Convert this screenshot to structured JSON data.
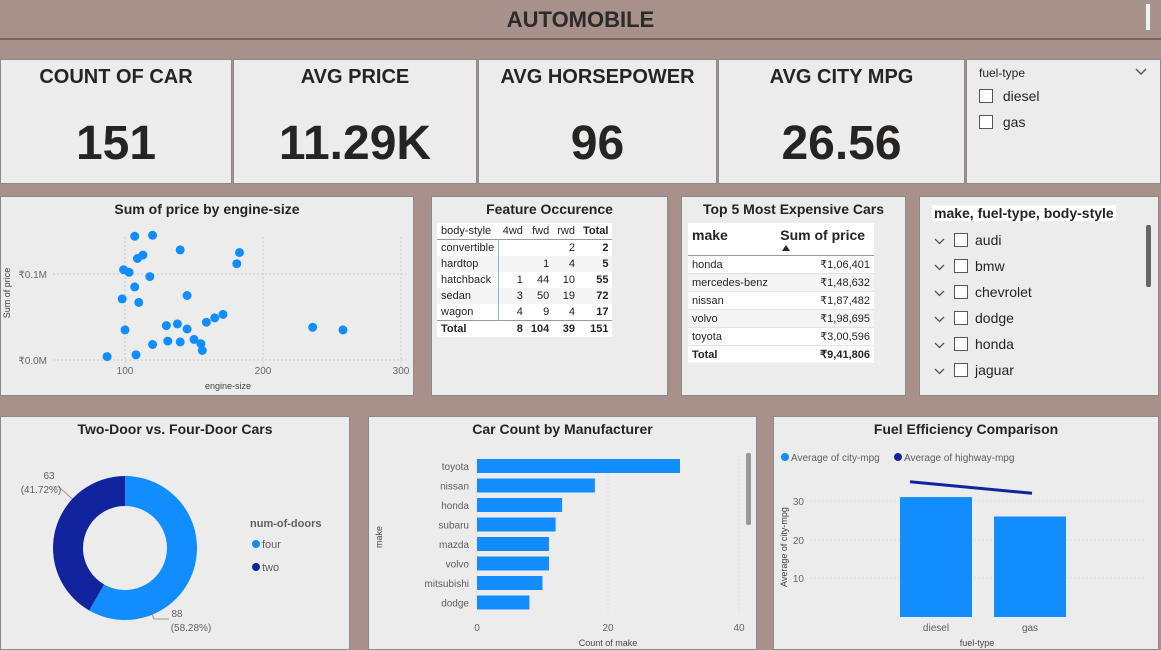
{
  "header": {
    "title": "AUTOMOBILE"
  },
  "cards": [
    {
      "label": "COUNT OF CAR",
      "value": "151"
    },
    {
      "label": "AVG PRICE",
      "value": "11.29K"
    },
    {
      "label": "AVG HORSEPOWER",
      "value": "96"
    },
    {
      "label": "AVG CITY MPG",
      "value": "26.56"
    }
  ],
  "fuel_slicer": {
    "title": "fuel-type",
    "options": [
      "diesel",
      "gas"
    ]
  },
  "scatter": {
    "title": "Sum of price by engine-size",
    "xlabel": "engine-size",
    "ylabel": "Sum of price",
    "xticks": [
      "100",
      "200",
      "300"
    ],
    "yticks": [
      "₹0.0M",
      "₹0.1M"
    ]
  },
  "feature_matrix": {
    "title": "Feature Occurence",
    "headers": [
      "body-style",
      "4wd",
      "fwd",
      "rwd",
      "Total"
    ],
    "rows": [
      [
        "convertible",
        "",
        "",
        "2",
        "2"
      ],
      [
        "hardtop",
        "",
        "1",
        "4",
        "5"
      ],
      [
        "hatchback",
        "1",
        "44",
        "10",
        "55"
      ],
      [
        "sedan",
        "3",
        "50",
        "19",
        "72"
      ],
      [
        "wagon",
        "4",
        "9",
        "4",
        "17"
      ]
    ],
    "total": [
      "Total",
      "8",
      "104",
      "39",
      "151"
    ]
  },
  "top5": {
    "title": "Top 5 Most Expensive Cars",
    "headers": [
      "make",
      "Sum of price"
    ],
    "rows": [
      [
        "honda",
        "₹1,06,401"
      ],
      [
        "mercedes-benz",
        "₹1,48,632"
      ],
      [
        "nissan",
        "₹1,87,482"
      ],
      [
        "volvo",
        "₹1,98,695"
      ],
      [
        "toyota",
        "₹3,00,596"
      ]
    ],
    "total": [
      "Total",
      "₹9,41,806"
    ]
  },
  "make_slicer": {
    "title": "make, fuel-type, body-style",
    "items": [
      "audi",
      "bmw",
      "chevrolet",
      "dodge",
      "honda",
      "jaguar"
    ]
  },
  "donut": {
    "title": "Two-Door vs. Four-Door Cars",
    "legend_title": "num-of-doors",
    "labels": [
      {
        "count": "63",
        "pct": "(41.72%)"
      },
      {
        "count": "88",
        "pct": "(58.28%)"
      }
    ]
  },
  "bar": {
    "title": "Car Count by Manufacturer",
    "xlabel": "Count of make",
    "ylabel": "make",
    "xticks": [
      "0",
      "20",
      "40"
    ]
  },
  "fuel_eff": {
    "title": "Fuel Efficiency Comparison",
    "ylabel": "Average of city-mpg",
    "xlabel": "fuel-type",
    "yticks": [
      "10",
      "20",
      "30"
    ]
  },
  "colors": {
    "primary": "#118dff",
    "secondary": "#12239e",
    "panel": "#ececec",
    "background": "#a8918a"
  },
  "chart_data": [
    {
      "type": "scatter",
      "title": "Sum of price by engine-size",
      "xlabel": "engine-size",
      "ylabel": "Sum of price",
      "xlim": [
        55,
        300
      ],
      "ylim": [
        -8000,
        165000
      ],
      "points": [
        [
          107,
          144000
        ],
        [
          120,
          145000
        ],
        [
          109,
          118000
        ],
        [
          113,
          122000
        ],
        [
          140,
          128000
        ],
        [
          183,
          125000
        ],
        [
          181,
          112000
        ],
        [
          99,
          105000
        ],
        [
          103,
          102000
        ],
        [
          118,
          97000
        ],
        [
          107,
          85000
        ],
        [
          145,
          75000
        ],
        [
          98,
          71000
        ],
        [
          110,
          67000
        ],
        [
          165,
          49000
        ],
        [
          171,
          53000
        ],
        [
          159,
          44000
        ],
        [
          130,
          40000
        ],
        [
          138,
          42000
        ],
        [
          100,
          35000
        ],
        [
          145,
          36000
        ],
        [
          150,
          24000
        ],
        [
          131,
          22000
        ],
        [
          140,
          21000
        ],
        [
          155,
          19000
        ],
        [
          120,
          18000
        ],
        [
          156,
          11000
        ],
        [
          236,
          38000
        ],
        [
          258,
          35000
        ],
        [
          108,
          6000
        ],
        [
          87,
          4000
        ]
      ]
    },
    {
      "type": "pie",
      "title": "Two-Door vs. Four-Door Cars",
      "categories": [
        "four",
        "two"
      ],
      "values": [
        88,
        63
      ],
      "legend": "right"
    },
    {
      "type": "bar",
      "title": "Car Count by Manufacturer",
      "categories": [
        "toyota",
        "nissan",
        "honda",
        "subaru",
        "mazda",
        "volvo",
        "mitsubishi",
        "dodge"
      ],
      "values": [
        31,
        18,
        13,
        12,
        11,
        11,
        10,
        8
      ],
      "xlabel": "Count of make",
      "ylabel": "make",
      "xlim": [
        0,
        40
      ]
    },
    {
      "type": "bar",
      "title": "Fuel Efficiency Comparison",
      "categories": [
        "diesel",
        "gas"
      ],
      "series": [
        {
          "name": "Average of city-mpg",
          "type": "bar",
          "values": [
            31,
            26
          ]
        },
        {
          "name": "Average of highway-mpg",
          "type": "line",
          "values": [
            35,
            32
          ]
        }
      ],
      "xlabel": "fuel-type",
      "ylabel": "Average of city-mpg",
      "ylim": [
        0,
        40
      ],
      "legend": "top-left"
    }
  ]
}
